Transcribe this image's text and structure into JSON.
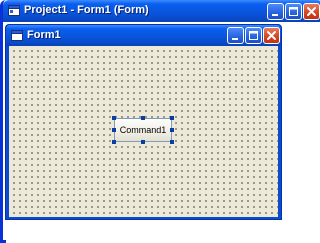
{
  "outer_window": {
    "title": "Project1 - Form1 (Form)",
    "buttons": [
      "minimize",
      "maximize",
      "close"
    ]
  },
  "form_window": {
    "title": "Form1",
    "buttons": [
      "minimize",
      "maximize",
      "close"
    ]
  },
  "form": {
    "command_button_label": "Command1",
    "selection_handles": 8
  },
  "icons": {
    "window_icon": "vb-form-icon",
    "minimize": "minimize-icon",
    "maximize": "maximize-icon",
    "close": "close-icon"
  },
  "colors": {
    "titlebar": "#0855dd",
    "close_button": "#d5431f",
    "form_background": "#ece9d8",
    "grid_dots": "#000000",
    "selection_handle": "#0a3ea0"
  }
}
